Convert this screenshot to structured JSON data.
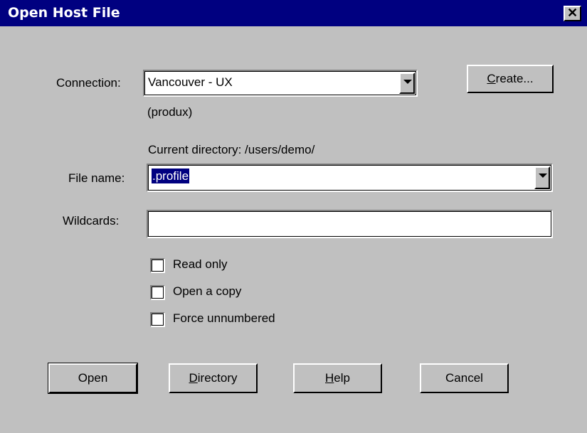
{
  "window": {
    "title": "Open Host File",
    "close_glyph": "✕"
  },
  "connection": {
    "label": "Connection:",
    "value": "Vancouver - UX",
    "host": "(produx)"
  },
  "create_button": {
    "accel": "C",
    "rest": "reate..."
  },
  "current_directory": "Current directory: /users/demo/",
  "file_name": {
    "label": "File name:",
    "value": ".profile"
  },
  "wildcards": {
    "label": "Wildcards:",
    "value": ""
  },
  "options": [
    {
      "label": "Read only",
      "checked": false
    },
    {
      "label": "Open a copy",
      "checked": false
    },
    {
      "label": "Force unnumbered",
      "checked": false
    }
  ],
  "buttons": {
    "open": "Open",
    "directory_accel": "D",
    "directory_rest": "irectory",
    "help_accel": "H",
    "help_rest": "elp",
    "cancel": "Cancel"
  },
  "colors": {
    "titlebar": "#000080",
    "dialog_bg": "#c0c0c0",
    "selection": "#000080"
  },
  "icons": {
    "close": "close-icon",
    "dropdown": "chevron-down-icon"
  }
}
